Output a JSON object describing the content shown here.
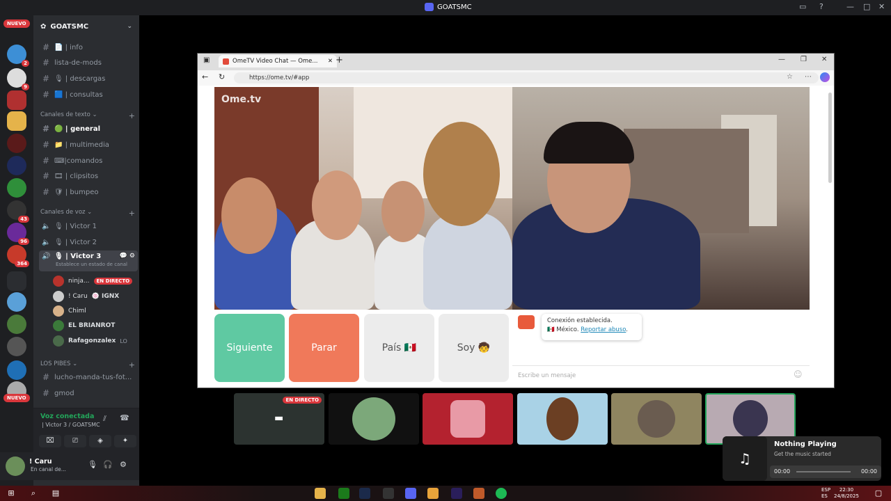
{
  "window": {
    "title": "GOATSMC"
  },
  "rail": {
    "new_badge_top": "NUEVO",
    "new_badge_bottom": "NUEVO",
    "badges": [
      "2",
      "9",
      "43",
      "96",
      "364"
    ]
  },
  "guild": {
    "name": "GOATSMC"
  },
  "channels_top": [
    {
      "name": "📄 | info"
    },
    {
      "name": "lista-de-mods"
    },
    {
      "name": "🎙 | descargas"
    },
    {
      "name": "🟦 | consultas"
    }
  ],
  "category_text": "Canales de texto",
  "text_channels": [
    {
      "name": "🟢 | general",
      "active": true
    },
    {
      "name": "📁 | multimedia"
    },
    {
      "name": "⌨|comandos"
    },
    {
      "name": "🎞 | clipsitos"
    },
    {
      "name": "🛡 | bumpeo"
    }
  ],
  "category_voice": "Canales de voz",
  "voice_channels": [
    {
      "name": "🎙 | Victor 1"
    },
    {
      "name": "🎙 | Victor 2"
    },
    {
      "name": "🎙 | Victor 3",
      "status": "Establece un estado de canal"
    }
  ],
  "members": [
    {
      "name": "ninja...",
      "live": "EN DIRECTO"
    },
    {
      "name": "! Caru",
      "extra": "🍥 IGNX"
    },
    {
      "name": "Chiml"
    },
    {
      "name": "EL BRIANROT"
    },
    {
      "name": "Rafagonzalex",
      "extra": "LO"
    }
  ],
  "category_pibes": "LOS PIBES",
  "pibes_channels": [
    {
      "name": "lucho-manda-tus-fot..."
    },
    {
      "name": "gmod"
    }
  ],
  "voice_connected": {
    "title": "Voz conectada",
    "subtitle": "| Victor 3 / GOATSMC"
  },
  "user": {
    "name": "! Caru",
    "status": "En canal de..."
  },
  "browser": {
    "tab_title": "OmeTV Video Chat — Ome...",
    "url": "https://ome.tv/#app"
  },
  "ometv": {
    "watermark": "Ome.tv",
    "buttons": {
      "next": "Siguiente",
      "stop": "Parar",
      "country": "País 🇲🇽",
      "me": "Soy 🧒"
    },
    "chat": {
      "message_line1": "Conexión establecida.",
      "message_country": "🇲🇽 México.",
      "report_link": "Reportar abuso",
      "input_placeholder": "Escribe un mensaje"
    }
  },
  "stream_tiles": [
    {
      "live": "EN DIRECTO"
    }
  ],
  "music": {
    "title": "Nothing Playing",
    "subtitle": "Get the music started",
    "time_start": "00:00",
    "time_end": "00:00"
  },
  "taskbar": {
    "lang1": "ESP",
    "lang2": "ES",
    "time": "22:30",
    "date": "24/8/2025"
  },
  "colors": {
    "accent_discord": "#5865f2",
    "live_red": "#da373c",
    "next_green": "#5fc9a2",
    "stop_orange": "#f0795a"
  }
}
